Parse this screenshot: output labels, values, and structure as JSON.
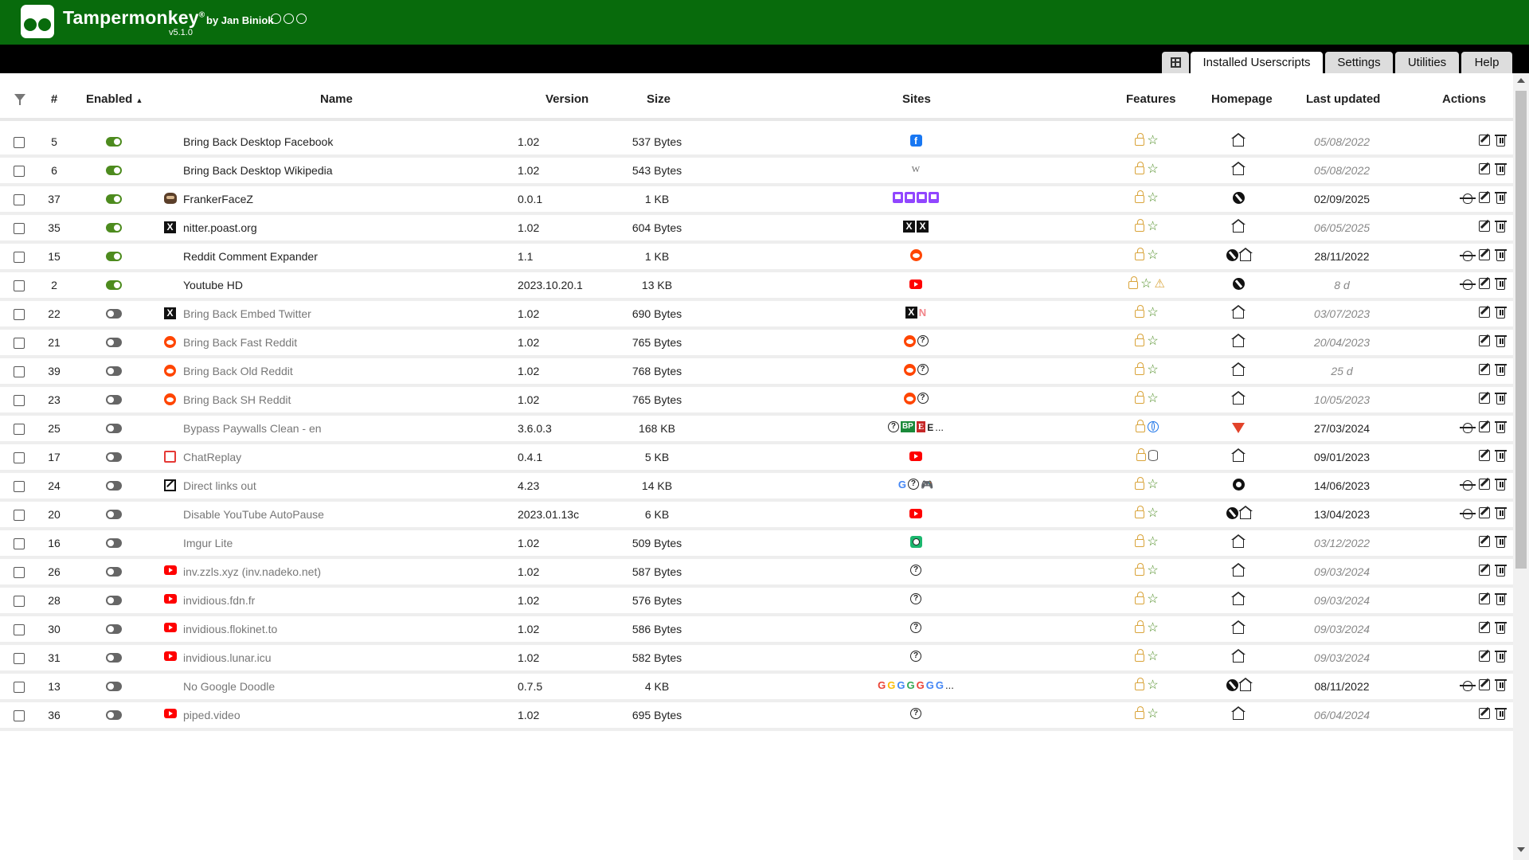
{
  "app": {
    "title": "Tampermonkey",
    "reg_mark": "®",
    "byline": "by Jan Biniok",
    "version": "v5.1.0",
    "header_color": "#086b0c"
  },
  "tabs": [
    {
      "label": "",
      "icon": "add-script-icon"
    },
    {
      "label": "Installed Userscripts",
      "active": true
    },
    {
      "label": "Settings"
    },
    {
      "label": "Utilities"
    },
    {
      "label": "Help"
    }
  ],
  "columns": {
    "num": "#",
    "enabled": "Enabled",
    "enabled_sort": "▲",
    "name": "Name",
    "version": "Version",
    "size": "Size",
    "sites": "Sites",
    "features": "Features",
    "homepage": "Homepage",
    "updated": "Last updated",
    "actions": "Actions"
  },
  "rows": [
    {
      "num": "5",
      "enabled": true,
      "icon": "",
      "name": "Bring Back Desktop Facebook",
      "version": "1.02",
      "size": "537 Bytes",
      "sites": [
        "facebook-icon"
      ],
      "features": [
        "lock",
        "star"
      ],
      "homepage": [
        "house"
      ],
      "updated": "05/08/2022",
      "updated_old": true,
      "actions": [
        "edit",
        "trash"
      ]
    },
    {
      "num": "6",
      "enabled": true,
      "icon": "",
      "name": "Bring Back Desktop Wikipedia",
      "version": "1.02",
      "size": "543 Bytes",
      "sites": [
        "wikipedia-icon"
      ],
      "features": [
        "lock",
        "star"
      ],
      "homepage": [
        "house"
      ],
      "updated": "05/08/2022",
      "updated_old": true,
      "actions": [
        "edit",
        "trash"
      ]
    },
    {
      "num": "37",
      "enabled": true,
      "icon": "ffz",
      "name": "FrankerFaceZ",
      "version": "0.0.1",
      "size": "1 KB",
      "sites": [
        "twitch-icon",
        "twitch-icon",
        "twitch-icon",
        "twitch-icon"
      ],
      "features": [
        "lock",
        "star"
      ],
      "homepage": [
        "support"
      ],
      "updated": "02/09/2025",
      "updated_old": false,
      "actions": [
        "bug",
        "edit",
        "trash"
      ]
    },
    {
      "num": "35",
      "enabled": true,
      "icon": "x",
      "name": "nitter.poast.org",
      "version": "1.02",
      "size": "604 Bytes",
      "sites": [
        "x-icon",
        "x-icon"
      ],
      "features": [
        "lock",
        "star"
      ],
      "homepage": [
        "house"
      ],
      "updated": "06/05/2025",
      "updated_old": true,
      "actions": [
        "edit",
        "trash"
      ]
    },
    {
      "num": "15",
      "enabled": true,
      "icon": "",
      "name": "Reddit Comment Expander",
      "version": "1.1",
      "size": "1 KB",
      "sites": [
        "reddit-icon"
      ],
      "features": [
        "lock",
        "star"
      ],
      "homepage": [
        "support",
        "house"
      ],
      "updated": "28/11/2022",
      "updated_old": false,
      "actions": [
        "bug",
        "edit",
        "trash"
      ]
    },
    {
      "num": "2",
      "enabled": true,
      "icon": "",
      "name": "Youtube HD",
      "version": "2023.10.20.1",
      "size": "13 KB",
      "sites": [
        "youtube-icon"
      ],
      "features": [
        "lock",
        "star",
        "warn"
      ],
      "homepage": [
        "support"
      ],
      "updated": "8 d",
      "updated_old": true,
      "actions": [
        "bug",
        "edit",
        "trash"
      ]
    },
    {
      "num": "22",
      "enabled": false,
      "icon": "x",
      "name": "Bring Back Embed Twitter",
      "version": "1.02",
      "size": "690 Bytes",
      "sites": [
        "x-icon",
        "netflix-icon"
      ],
      "features": [
        "lock",
        "star"
      ],
      "homepage": [
        "house"
      ],
      "updated": "03/07/2023",
      "updated_old": true,
      "actions": [
        "edit",
        "trash"
      ]
    },
    {
      "num": "21",
      "enabled": false,
      "icon": "reddit",
      "name": "Bring Back Fast Reddit",
      "version": "1.02",
      "size": "765 Bytes",
      "sites": [
        "reddit-icon",
        "question-icon"
      ],
      "features": [
        "lock",
        "star"
      ],
      "homepage": [
        "house"
      ],
      "updated": "20/04/2023",
      "updated_old": true,
      "actions": [
        "edit",
        "trash"
      ]
    },
    {
      "num": "39",
      "enabled": false,
      "icon": "reddit",
      "name": "Bring Back Old Reddit",
      "version": "1.02",
      "size": "768 Bytes",
      "sites": [
        "reddit-icon",
        "question-icon"
      ],
      "features": [
        "lock",
        "star"
      ],
      "homepage": [
        "house"
      ],
      "updated": "25 d",
      "updated_old": true,
      "actions": [
        "edit",
        "trash"
      ]
    },
    {
      "num": "23",
      "enabled": false,
      "icon": "reddit",
      "name": "Bring Back SH Reddit",
      "version": "1.02",
      "size": "765 Bytes",
      "sites": [
        "reddit-icon",
        "question-icon"
      ],
      "features": [
        "lock",
        "star"
      ],
      "homepage": [
        "house"
      ],
      "updated": "10/05/2023",
      "updated_old": true,
      "actions": [
        "edit",
        "trash"
      ]
    },
    {
      "num": "25",
      "enabled": false,
      "icon": "",
      "name": "Bypass Paywalls Clean - en",
      "version": "3.6.0.3",
      "size": "168 KB",
      "sites": [
        "question-icon",
        "bp-icon",
        "e-box-icon",
        "e-letter-icon",
        "ellipsis"
      ],
      "features": [
        "lock",
        "globe"
      ],
      "homepage": [
        "gitlab"
      ],
      "updated": "27/03/2024",
      "updated_old": false,
      "actions": [
        "bug",
        "edit",
        "trash"
      ]
    },
    {
      "num": "17",
      "enabled": false,
      "icon": "chatreplay",
      "name": "ChatReplay",
      "version": "0.4.1",
      "size": "5 KB",
      "sites": [
        "youtube-icon"
      ],
      "features": [
        "lock",
        "db"
      ],
      "homepage": [
        "house"
      ],
      "updated": "09/01/2023",
      "updated_old": false,
      "actions": [
        "edit",
        "trash"
      ]
    },
    {
      "num": "24",
      "enabled": false,
      "icon": "extlink",
      "name": "Direct links out",
      "version": "4.23",
      "size": "14 KB",
      "sites": [
        "google-icon",
        "question-icon",
        "gamepad-icon"
      ],
      "features": [
        "lock",
        "star"
      ],
      "homepage": [
        "github"
      ],
      "updated": "14/06/2023",
      "updated_old": false,
      "actions": [
        "bug",
        "edit",
        "trash"
      ]
    },
    {
      "num": "20",
      "enabled": false,
      "icon": "",
      "name": "Disable YouTube AutoPause",
      "version": "2023.01.13c",
      "size": "6 KB",
      "sites": [
        "youtube-icon"
      ],
      "features": [
        "lock",
        "star"
      ],
      "homepage": [
        "support",
        "house"
      ],
      "updated": "13/04/2023",
      "updated_old": false,
      "actions": [
        "bug",
        "edit",
        "trash"
      ]
    },
    {
      "num": "16",
      "enabled": false,
      "icon": "",
      "name": "Imgur Lite",
      "version": "1.02",
      "size": "509 Bytes",
      "sites": [
        "imgur-icon"
      ],
      "features": [
        "lock",
        "star"
      ],
      "homepage": [
        "house"
      ],
      "updated": "03/12/2022",
      "updated_old": true,
      "actions": [
        "edit",
        "trash"
      ]
    },
    {
      "num": "26",
      "enabled": false,
      "icon": "yt",
      "name": "inv.zzls.xyz (inv.nadeko.net)",
      "version": "1.02",
      "size": "587 Bytes",
      "sites": [
        "question-icon"
      ],
      "features": [
        "lock",
        "star"
      ],
      "homepage": [
        "house"
      ],
      "updated": "09/03/2024",
      "updated_old": true,
      "actions": [
        "edit",
        "trash"
      ]
    },
    {
      "num": "28",
      "enabled": false,
      "icon": "yt",
      "name": "invidious.fdn.fr",
      "version": "1.02",
      "size": "576 Bytes",
      "sites": [
        "question-icon"
      ],
      "features": [
        "lock",
        "star"
      ],
      "homepage": [
        "house"
      ],
      "updated": "09/03/2024",
      "updated_old": true,
      "actions": [
        "edit",
        "trash"
      ]
    },
    {
      "num": "30",
      "enabled": false,
      "icon": "yt",
      "name": "invidious.flokinet.to",
      "version": "1.02",
      "size": "586 Bytes",
      "sites": [
        "question-icon"
      ],
      "features": [
        "lock",
        "star"
      ],
      "homepage": [
        "house"
      ],
      "updated": "09/03/2024",
      "updated_old": true,
      "actions": [
        "edit",
        "trash"
      ]
    },
    {
      "num": "31",
      "enabled": false,
      "icon": "yt",
      "name": "invidious.lunar.icu",
      "version": "1.02",
      "size": "582 Bytes",
      "sites": [
        "question-icon"
      ],
      "features": [
        "lock",
        "star"
      ],
      "homepage": [
        "house"
      ],
      "updated": "09/03/2024",
      "updated_old": true,
      "actions": [
        "edit",
        "trash"
      ]
    },
    {
      "num": "13",
      "enabled": false,
      "icon": "",
      "name": "No Google Doodle",
      "version": "0.7.5",
      "size": "4 KB",
      "sites": [
        "google-icon",
        "google-icon",
        "google-icon",
        "google-icon",
        "google-icon",
        "google-icon",
        "google-icon",
        "ellipsis"
      ],
      "features": [
        "lock",
        "star"
      ],
      "homepage": [
        "support",
        "house"
      ],
      "updated": "08/11/2022",
      "updated_old": false,
      "actions": [
        "bug",
        "edit",
        "trash"
      ]
    },
    {
      "num": "36",
      "enabled": false,
      "icon": "yt",
      "name": "piped.video",
      "version": "1.02",
      "size": "695 Bytes",
      "sites": [
        "question-icon"
      ],
      "features": [
        "lock",
        "star"
      ],
      "homepage": [
        "house"
      ],
      "updated": "06/04/2024",
      "updated_old": true,
      "actions": [
        "edit",
        "trash"
      ]
    }
  ]
}
